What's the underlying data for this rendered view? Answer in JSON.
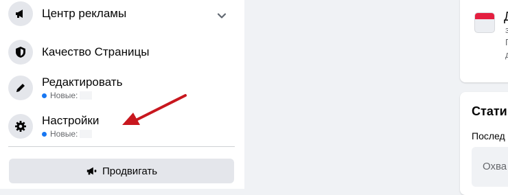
{
  "sidebar": {
    "items": [
      {
        "label": "Центр рекламы",
        "icon": "megaphone-icon"
      },
      {
        "label": "Качество Страницы",
        "icon": "shield-icon"
      },
      {
        "label": "Редактировать",
        "icon": "pencil-icon",
        "sub": "Новые:"
      },
      {
        "label": "Настройки",
        "icon": "gear-icon",
        "sub": "Новые:"
      }
    ],
    "promote_label": "Продвигать"
  },
  "right": {
    "top_card": {
      "letter": "Д",
      "frags": [
        "з",
        "П",
        "д"
      ]
    },
    "stats": {
      "title": "Стати",
      "subtitle": "Послед",
      "box_text": "Охва"
    }
  },
  "colors": {
    "accent_dot": "#1877f2",
    "arrow": "#c8171e",
    "calendar_red": "#e41e3f"
  }
}
